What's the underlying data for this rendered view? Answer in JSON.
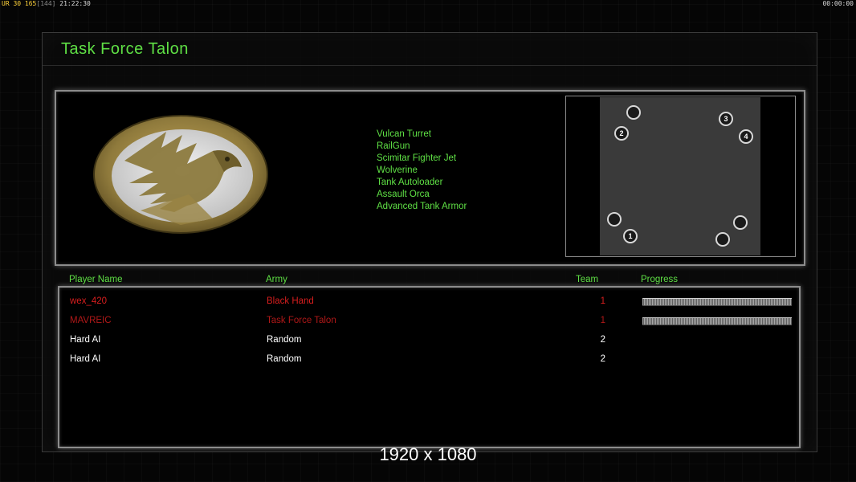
{
  "hud": {
    "left_a": "UR",
    "left_b": "30 165",
    "left_c": "[144]",
    "left_d": "21:22:30",
    "right": "00:00:00"
  },
  "title": "Task Force Talon",
  "upgrades": [
    "Vulcan Turret",
    "RailGun",
    "Scimitar Fighter Jet",
    "Wolverine",
    "Tank Autoloader",
    "Assault Orca",
    "Advanced Tank Armor"
  ],
  "minimap": {
    "spawns": [
      {
        "label": ""
      },
      {
        "label": "2"
      },
      {
        "label": "3"
      },
      {
        "label": "4"
      },
      {
        "label": ""
      },
      {
        "label": "1"
      },
      {
        "label": ""
      },
      {
        "label": ""
      }
    ]
  },
  "columns": {
    "player": "Player Name",
    "army": "Army",
    "team": "Team",
    "progress": "Progress"
  },
  "players": [
    {
      "name": "wex_420",
      "army": "Black Hand",
      "team": "1",
      "progress": 1.0
    },
    {
      "name": "MAVREIC",
      "army": "Task Force Talon",
      "team": "1",
      "progress": 1.0
    },
    {
      "name": "Hard AI",
      "army": "Random",
      "team": "2"
    },
    {
      "name": "Hard AI",
      "army": "Random",
      "team": "2"
    }
  ],
  "resolution": "1920 x 1080",
  "colors": {
    "accent_green": "#5fe045",
    "enemy_red": "#d81e1e"
  },
  "icons": {
    "emblem": "eagle-emblem-icon"
  }
}
